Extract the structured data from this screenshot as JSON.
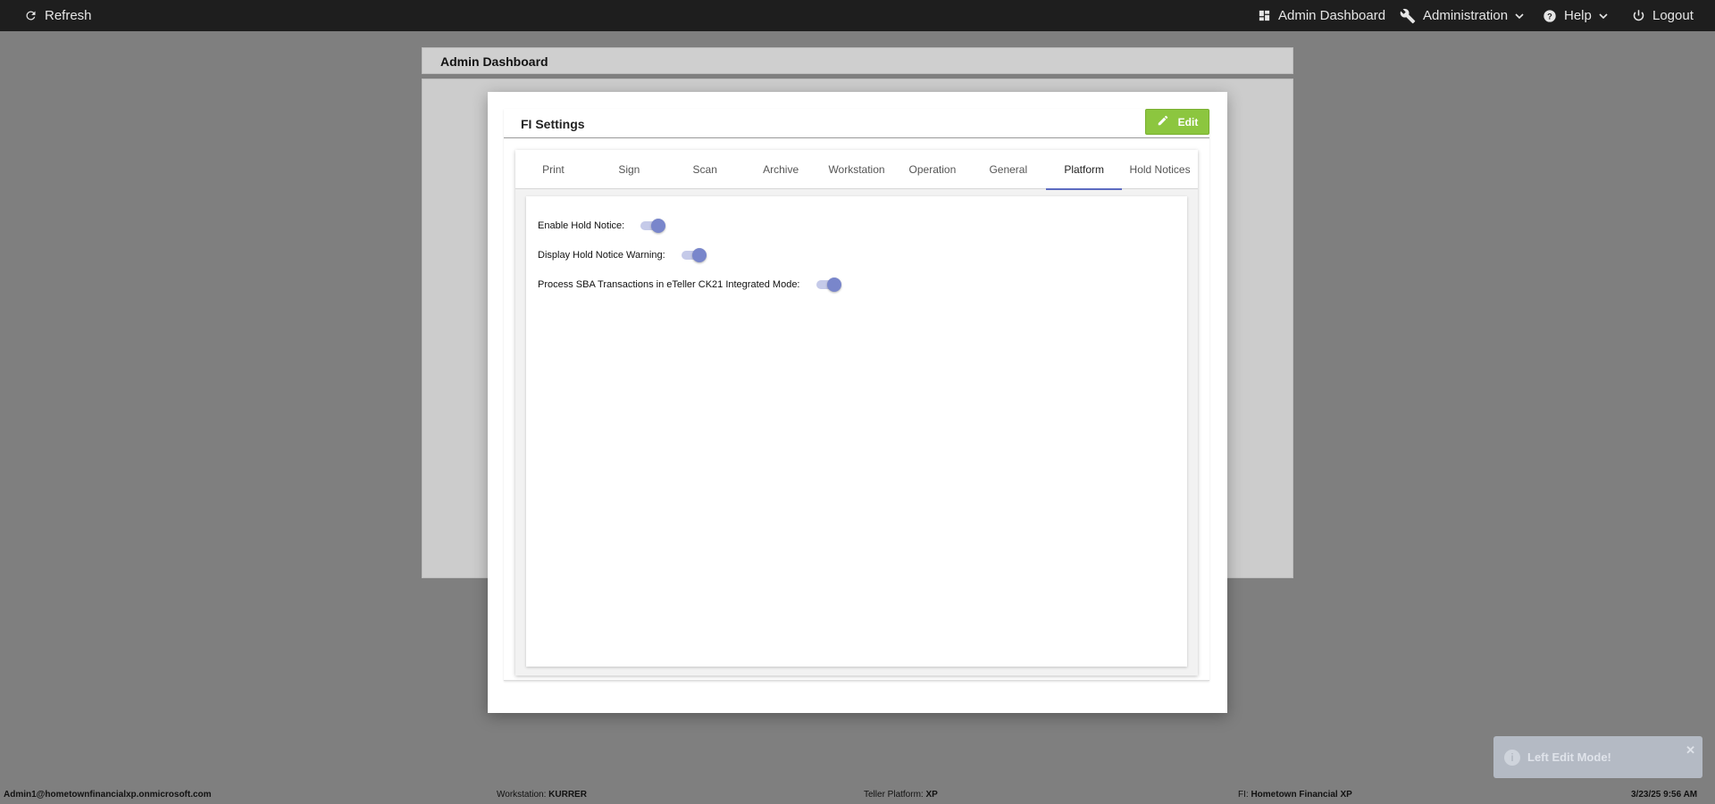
{
  "topbar": {
    "refresh_label": "Refresh",
    "admin_dashboard_label": "Admin Dashboard",
    "administration_label": "Administration",
    "help_label": "Help",
    "logout_label": "Logout"
  },
  "background_page": {
    "title": "Admin Dashboard"
  },
  "modal": {
    "title": "FI Settings",
    "edit_label": "Edit",
    "tabs": [
      {
        "label": "Print"
      },
      {
        "label": "Sign"
      },
      {
        "label": "Scan"
      },
      {
        "label": "Archive"
      },
      {
        "label": "Workstation"
      },
      {
        "label": "Operation"
      },
      {
        "label": "General"
      },
      {
        "label": "Platform",
        "active": true
      },
      {
        "label": "Hold Notices"
      }
    ],
    "settings": [
      {
        "label": "Enable Hold Notice:",
        "enabled": true
      },
      {
        "label": "Display Hold Notice Warning:",
        "enabled": true
      },
      {
        "label": "Process SBA Transactions in eTeller CK21 Integrated Mode:",
        "enabled": true
      }
    ]
  },
  "toast": {
    "message": "Left Edit Mode!",
    "close_glyph": "✕",
    "info_glyph": "i"
  },
  "footer": {
    "user": "Admin1@hometownfinancialxp.onmicrosoft.com",
    "workstation_label": "Workstation:",
    "workstation_value": "KURRER",
    "teller_platform_label": "Teller Platform:",
    "teller_platform_value": "XP",
    "fi_label": "FI:",
    "fi_value": "Hometown Financial XP",
    "datetime": "3/23/25 9:56 AM"
  },
  "colors": {
    "topbar": "#1e1e1e",
    "overlay": "#7f7f7f",
    "edit_button": "#8cc63f",
    "tab_indicator": "#5c6bc0",
    "toggle_knob": "#7986cb",
    "toggle_track": "#c5cae9"
  }
}
